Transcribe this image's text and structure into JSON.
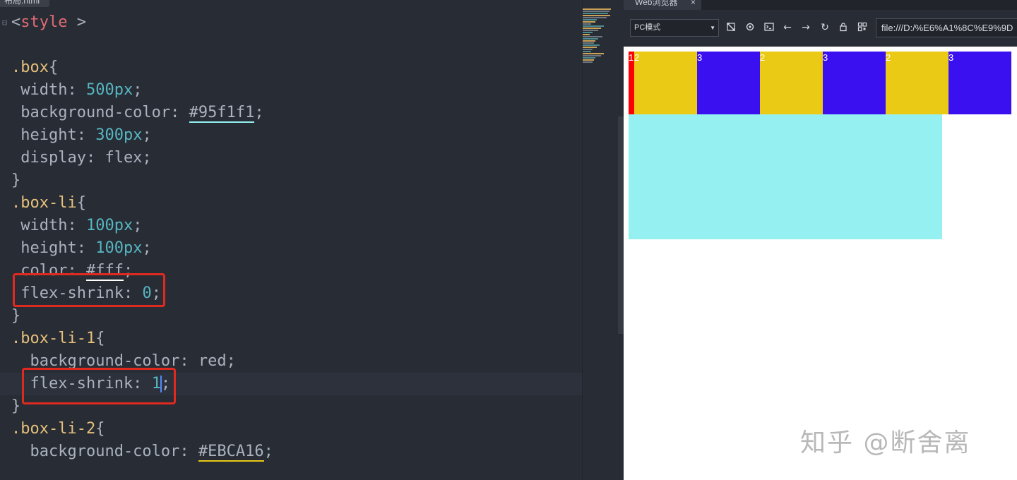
{
  "editor": {
    "file_tab": "布局.html",
    "lines": [
      {
        "key": "l1",
        "segs": [
          {
            "t": "<",
            "c": "c-prop"
          },
          {
            "t": "style",
            "c": "c-tag"
          },
          {
            "t": " >",
            "c": "c-prop"
          }
        ]
      },
      {
        "key": "l2",
        "segs": []
      },
      {
        "key": "l3",
        "segs": [
          {
            "t": ".box",
            "c": "c-sel"
          },
          {
            "t": "{",
            "c": "c-prop"
          }
        ]
      },
      {
        "key": "l4",
        "segs": [
          {
            "t": " width: ",
            "c": "c-prop"
          },
          {
            "t": "500px",
            "c": "c-num"
          },
          {
            "t": ";",
            "c": "c-prop"
          }
        ]
      },
      {
        "key": "l5",
        "segs": [
          {
            "t": " background-color: ",
            "c": "c-prop"
          },
          {
            "t": "#95f1f1",
            "c": "c-hex u-cyan"
          },
          {
            "t": ";",
            "c": "c-prop"
          }
        ]
      },
      {
        "key": "l6",
        "segs": [
          {
            "t": " height: ",
            "c": "c-prop"
          },
          {
            "t": "300px",
            "c": "c-num"
          },
          {
            "t": ";",
            "c": "c-prop"
          }
        ]
      },
      {
        "key": "l7",
        "segs": [
          {
            "t": " display: flex;",
            "c": "c-prop"
          }
        ]
      },
      {
        "key": "l8",
        "segs": [
          {
            "t": "}",
            "c": "c-prop"
          }
        ]
      },
      {
        "key": "l9",
        "segs": [
          {
            "t": ".box-li",
            "c": "c-sel"
          },
          {
            "t": "{",
            "c": "c-prop"
          }
        ]
      },
      {
        "key": "l10",
        "segs": [
          {
            "t": " width: ",
            "c": "c-prop"
          },
          {
            "t": "100px",
            "c": "c-num"
          },
          {
            "t": ";",
            "c": "c-prop"
          }
        ]
      },
      {
        "key": "l11",
        "segs": [
          {
            "t": " height: ",
            "c": "c-prop"
          },
          {
            "t": "100px",
            "c": "c-num"
          },
          {
            "t": ";",
            "c": "c-prop"
          }
        ]
      },
      {
        "key": "l12",
        "segs": [
          {
            "t": " color: ",
            "c": "c-prop"
          },
          {
            "t": "#fff",
            "c": "c-hex u-white"
          },
          {
            "t": ";",
            "c": "c-prop"
          }
        ]
      },
      {
        "key": "l13",
        "segs": [
          {
            "t": " flex-shrink: ",
            "c": "c-prop"
          },
          {
            "t": "0",
            "c": "c-num"
          },
          {
            "t": ";",
            "c": "c-prop"
          }
        ]
      },
      {
        "key": "l14",
        "segs": [
          {
            "t": "}",
            "c": "c-prop"
          }
        ]
      },
      {
        "key": "l15",
        "segs": [
          {
            "t": ".box-li-1",
            "c": "c-sel"
          },
          {
            "t": "{",
            "c": "c-prop"
          }
        ]
      },
      {
        "key": "l16",
        "segs": [
          {
            "t": "  background-color: red;",
            "c": "c-prop"
          }
        ]
      },
      {
        "key": "l17",
        "segs": [
          {
            "t": "  flex-shrink: ",
            "c": "c-prop"
          },
          {
            "t": "1",
            "c": "c-num"
          },
          {
            "t": "|cursor|",
            "c": ""
          },
          {
            "t": ";",
            "c": "c-prop"
          }
        ]
      },
      {
        "key": "l18",
        "segs": [
          {
            "t": "}",
            "c": "c-prop"
          }
        ]
      },
      {
        "key": "l19",
        "segs": [
          {
            "t": ".box-li-2",
            "c": "c-sel"
          },
          {
            "t": "{",
            "c": "c-prop"
          }
        ]
      },
      {
        "key": "l20",
        "segs": [
          {
            "t": "  background-color: ",
            "c": "c-prop"
          },
          {
            "t": "#EBCA16",
            "c": "c-hex u-yellow"
          },
          {
            "t": ";",
            "c": "c-prop"
          }
        ]
      }
    ],
    "active_line_index": 16,
    "colors": {
      "background": "#282c34",
      "selector": "#e5c07b",
      "tag": "#e06c75",
      "number": "#56b6c2",
      "text": "#abb2bf",
      "annotation": "#e02a20"
    }
  },
  "browser": {
    "tab_title": "Web浏览器",
    "tab_close": "×",
    "mode_select_value": "PC模式",
    "toolbar_icons": [
      "screenshot-icon",
      "settings-icon",
      "terminal-icon",
      "back-arrow-icon",
      "forward-arrow-icon",
      "refresh-icon",
      "lock-icon",
      "qrcode-icon"
    ],
    "url": "file:///D:/%E6%A1%8C%E9%9D",
    "flex_items": [
      {
        "label": "1",
        "color": "#ff0000"
      },
      {
        "label": "2",
        "color": "#ebca16"
      },
      {
        "label": "3",
        "color": "#3a10f0"
      },
      {
        "label": "2",
        "color": "#ebca16"
      },
      {
        "label": "3",
        "color": "#3a10f0"
      },
      {
        "label": "2",
        "color": "#ebca16"
      },
      {
        "label": "3",
        "color": "#3a10f0"
      }
    ],
    "box_color": "#95f1f1",
    "watermark": "知乎 @断舍离"
  }
}
